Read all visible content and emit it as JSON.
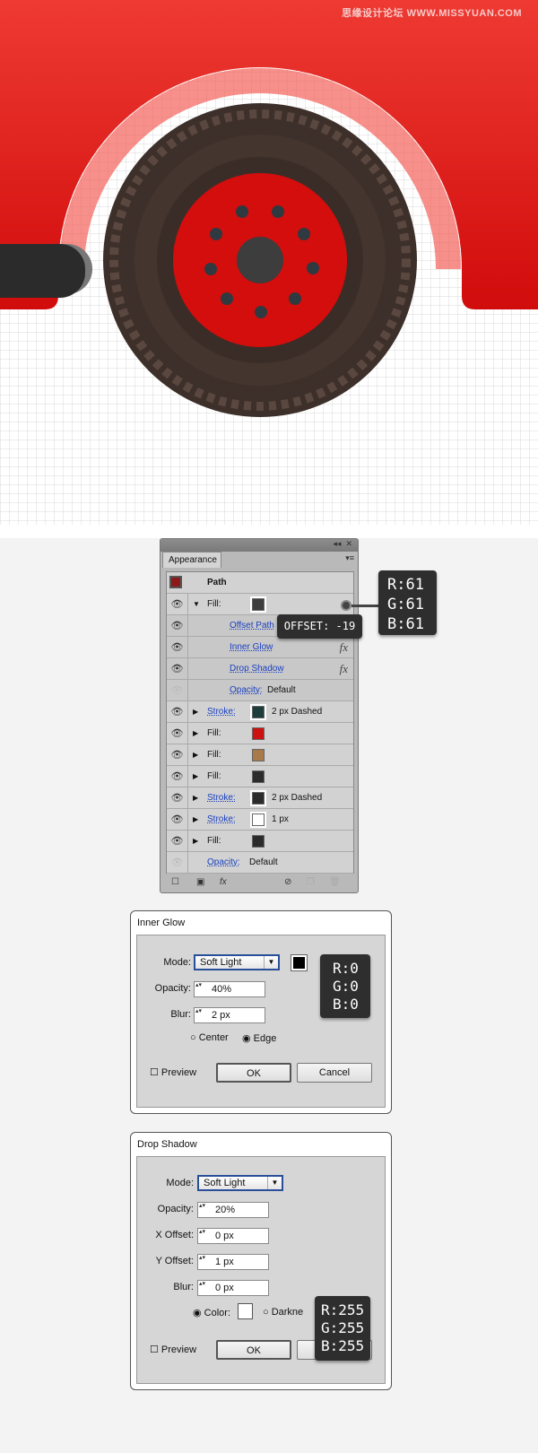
{
  "watermark": "思缘设计论坛 WWW.MISSYUAN.COM",
  "appearance": {
    "title": "Appearance",
    "collapse": "◂◂",
    "close": "✕",
    "menu": "▾≡",
    "path_label": "Path",
    "rows": [
      {
        "label": "Fill:",
        "link": false,
        "swatch": "#3d3d3d",
        "value": "",
        "expanded": true
      },
      {
        "label": "Offset Path",
        "link": true,
        "sub": true
      },
      {
        "label": "Inner Glow",
        "link": true,
        "sub": true,
        "fx": "fx"
      },
      {
        "label": "Drop Shadow",
        "link": true,
        "sub": true,
        "fx": "fx"
      },
      {
        "label": "Opacity:",
        "link": true,
        "sub": true,
        "value": "Default",
        "hidden": true
      },
      {
        "label": "Stroke:",
        "link": true,
        "swatch": "#1e3c3c",
        "value": "2 px Dashed"
      },
      {
        "label": "Fill:",
        "swatch": "#cc1111"
      },
      {
        "label": "Fill:",
        "swatch": "#a87a4a"
      },
      {
        "label": "Fill:",
        "swatch": "#2b2b2b"
      },
      {
        "label": "Stroke:",
        "link": true,
        "swatch": "#2b2b2b",
        "value": "2 px Dashed"
      },
      {
        "label": "Stroke:",
        "link": true,
        "swatch": "#ffffff",
        "value": "1 px"
      },
      {
        "label": "Fill:",
        "swatch": "#2b2b2b"
      },
      {
        "label": "Opacity:",
        "link": true,
        "value": "Default",
        "hidden": true,
        "notri": true
      }
    ],
    "footer_fx": "fx"
  },
  "tooltips": {
    "offset": "OFFSET: -19",
    "fill_rgb": [
      "R:61",
      "G:61",
      "B:61"
    ],
    "glow_rgb": [
      "R:0",
      "G:0",
      "B:0"
    ],
    "shadow_rgb": [
      "R:255",
      "G:255",
      "B:255"
    ]
  },
  "inner_glow": {
    "title": "Inner Glow",
    "mode_label": "Mode:",
    "mode": "Soft Light",
    "color": "#000000",
    "opacity_label": "Opacity:",
    "opacity": "40%",
    "blur_label": "Blur:",
    "blur": "2 px",
    "center": "Center",
    "edge": "Edge",
    "selected": "Edge",
    "preview": "Preview",
    "ok": "OK",
    "cancel": "Cancel"
  },
  "drop_shadow": {
    "title": "Drop Shadow",
    "mode_label": "Mode:",
    "mode": "Soft Light",
    "opacity_label": "Opacity:",
    "opacity": "20%",
    "x_label": "X Offset:",
    "x": "0 px",
    "y_label": "Y Offset:",
    "y": "1 px",
    "blur_label": "Blur:",
    "blur": "0 px",
    "color_label": "Color:",
    "color": "#ffffff",
    "darkness": "Darkne",
    "selected": "Color",
    "preview": "Preview",
    "ok": "OK",
    "cancel": "Cancel"
  }
}
